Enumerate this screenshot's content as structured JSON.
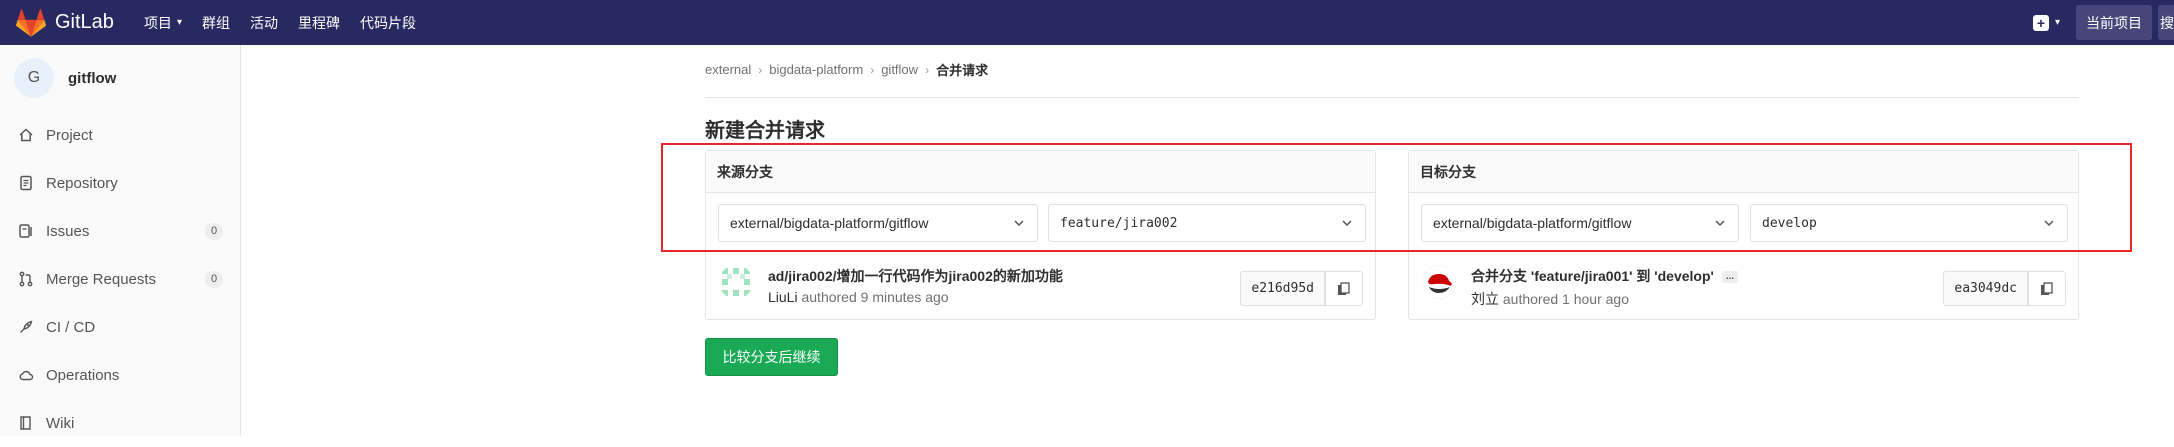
{
  "navbar": {
    "brand": "GitLab",
    "links": [
      {
        "label": "项目",
        "has_caret": true
      },
      {
        "label": "群组"
      },
      {
        "label": "活动"
      },
      {
        "label": "里程碑"
      },
      {
        "label": "代码片段"
      }
    ],
    "current_project_label": "当前项目",
    "search_edge_label": "搜",
    "bg_color": "#292961"
  },
  "sidebar": {
    "project_avatar_letter": "G",
    "project_name": "gitflow",
    "items": [
      {
        "label": "Project",
        "icon": "home-icon"
      },
      {
        "label": "Repository",
        "icon": "doc-icon"
      },
      {
        "label": "Issues",
        "icon": "issues-icon",
        "count": "0"
      },
      {
        "label": "Merge Requests",
        "icon": "merge-request-icon",
        "count": "0"
      },
      {
        "label": "CI / CD",
        "icon": "rocket-icon"
      },
      {
        "label": "Operations",
        "icon": "cloud-icon"
      },
      {
        "label": "Wiki",
        "icon": "book-icon"
      }
    ]
  },
  "breadcrumb": [
    "external",
    "bigdata-platform",
    "gitflow",
    "合并请求"
  ],
  "page_title": "新建合并请求",
  "source": {
    "header": "来源分支",
    "project": "external/bigdata-platform/gitflow",
    "branch": "feature/jira002",
    "commit": {
      "title": "ad/jira002/增加一行代码作为jira002的新加功能",
      "author": "LiuLi",
      "time_text": "authored 9 minutes ago",
      "sha": "e216d95d"
    }
  },
  "target": {
    "header": "目标分支",
    "project": "external/bigdata-platform/gitflow",
    "branch": "develop",
    "commit": {
      "title": "合并分支 'feature/jira001' 到 'develop'",
      "ellipsis": "...",
      "author": "刘立",
      "time_text": "authored 1 hour ago",
      "sha": "ea3049dc"
    }
  },
  "continue_button": "比较分支后继续",
  "colors": {
    "accent_green": "#1aaa55",
    "highlight_red": "#e8262a"
  }
}
